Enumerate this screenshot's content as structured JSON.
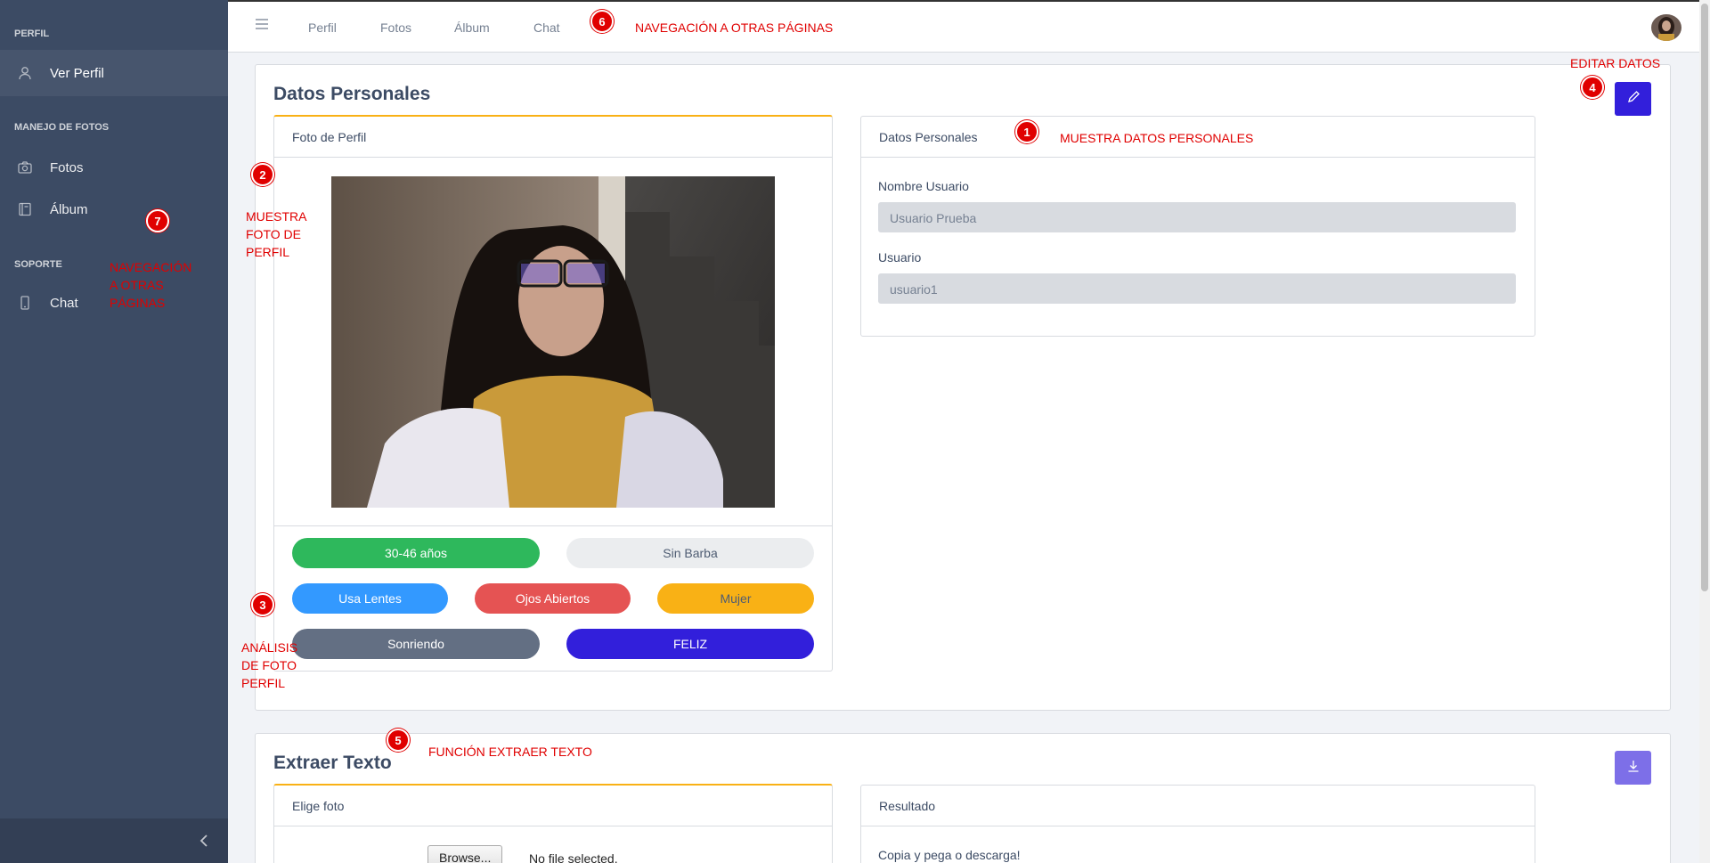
{
  "sidebar": {
    "sections": [
      "PERFIL",
      "MANEJO DE FOTOS",
      "SOPORTE"
    ],
    "items": [
      {
        "label": "Ver Perfil",
        "icon": "user-icon"
      },
      {
        "label": "Fotos",
        "icon": "camera-icon"
      },
      {
        "label": "Álbum",
        "icon": "book-icon"
      },
      {
        "label": "Chat",
        "icon": "phone-icon"
      }
    ]
  },
  "header": {
    "nav": [
      "Perfil",
      "Fotos",
      "Álbum",
      "Chat"
    ]
  },
  "profile": {
    "title": "Datos Personales",
    "photo_card_title": "Foto de Perfil",
    "data_card_title": "Datos Personales",
    "fields": [
      {
        "label": "Nombre Usuario",
        "value": "Usuario Prueba"
      },
      {
        "label": "Usuario",
        "value": "usuario1"
      }
    ],
    "tags": {
      "age": "30-46 años",
      "beard": "Sin Barba",
      "glasses": "Usa Lentes",
      "eyes": "Ojos Abiertos",
      "gender": "Mujer",
      "smile": "Sonriendo",
      "emotion": "FELIZ"
    }
  },
  "extract": {
    "title": "Extraer Texto",
    "choose_card_title": "Elige foto",
    "browse_label": "Browse...",
    "no_file": "No file selected.",
    "result_card_title": "Resultado",
    "result_text": "Copia y pega o descarga!"
  },
  "annotations": {
    "m1": "1",
    "a1": "MUESTRA DATOS PERSONALES",
    "m2": "2",
    "a2": "MUESTRA FOTO DE PERFIL",
    "m3": "3",
    "a3": "ANÁLISIS DE FOTO PERFIL",
    "m4": "4",
    "a4": "EDITAR DATOS",
    "m5": "5",
    "a5": "FUNCIÓN EXTRAER TEXTO",
    "m6": "6",
    "a6": "NAVEGACIÓN A OTRAS PÁGINAS",
    "m7": "7",
    "a7": "NAVEGACIÓN A OTRAS PÁGINAS"
  },
  "colors": {
    "sidebar": "#3c4b64",
    "edit_button": "#321fdb",
    "download_button": "#7d6fe8",
    "age": "#2eb85c",
    "beard": "#ebedef",
    "glasses": "#3399ff",
    "eyes": "#e55353",
    "gender": "#f9b115",
    "smile": "#636f83",
    "emotion": "#321fdb",
    "annotation": "#e00000"
  }
}
